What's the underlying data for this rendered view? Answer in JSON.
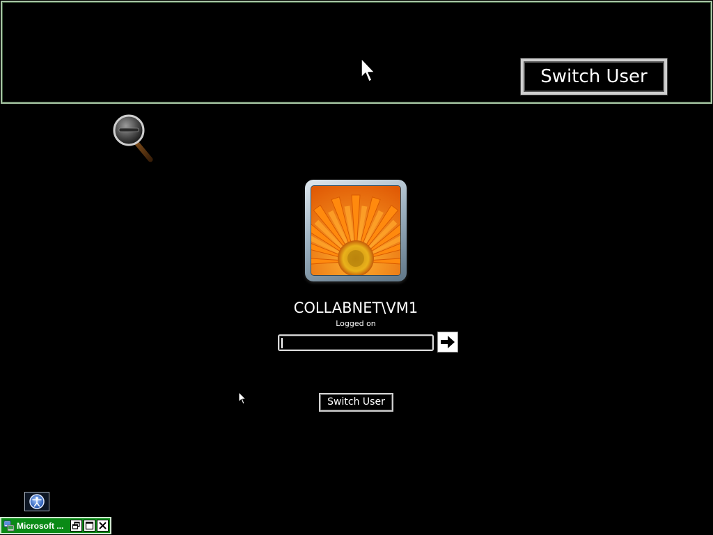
{
  "magnifier": {
    "switch_user_label": "Switch User"
  },
  "login": {
    "username": "COLLABNET\\VM1",
    "status": "Logged on",
    "password_value": "",
    "password_placeholder": "",
    "switch_user_label": "Switch User",
    "user_picture": "orange-flower"
  },
  "taskbar": {
    "minimized_title": "Microsoft ...",
    "icons": [
      "restore-icon",
      "maximize-icon",
      "close-icon"
    ]
  },
  "colors": {
    "background": "#000000",
    "magnifier_border": "#a7c4a4",
    "taskbar_green": "#0a8a16",
    "flower_orange": "#e87a10"
  }
}
